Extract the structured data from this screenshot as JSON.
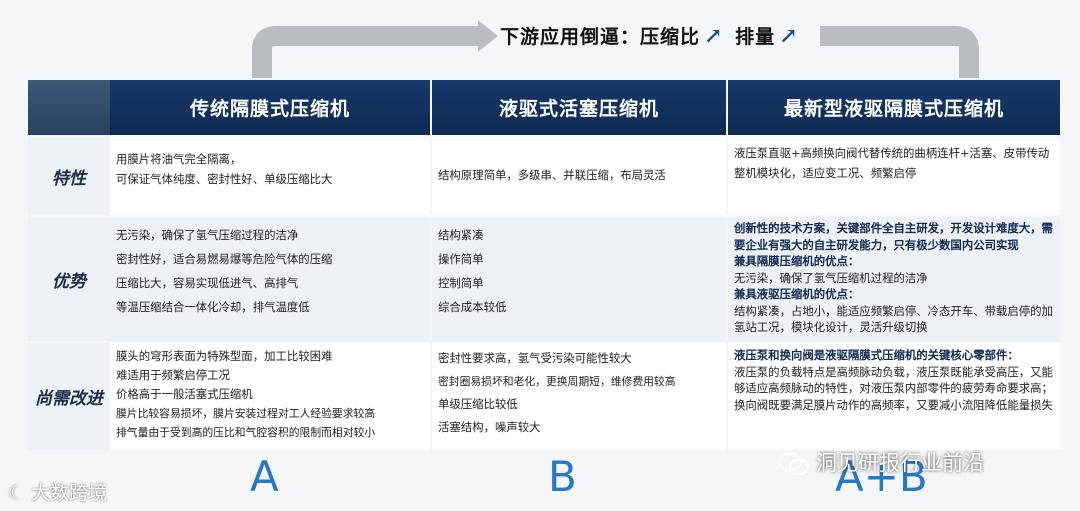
{
  "headline": {
    "text1": "下游应用倒逼：压缩比",
    "text2": "排量",
    "arrow_glyph": "↗"
  },
  "columns": [
    "传统隔膜式压缩机",
    "液驱式活塞压缩机",
    "最新型液驱隔膜式压缩机"
  ],
  "rows": [
    {
      "label": "特性",
      "col1": [
        "用膜片将油气完全隔离，",
        "可保证气体纯度、密封性好、单级压缩比大"
      ],
      "col2": [
        "结构原理简单，多级串、并联压缩，布局灵活"
      ],
      "col3": [
        "液压泵直驱+高频换向阀代替传统的曲柄连杆+活塞、皮带传动",
        "整机模块化，适应变工况、频繁启停"
      ]
    },
    {
      "label": "优势",
      "col1": [
        "无污染，确保了氢气压缩过程的洁净",
        "密封性好，适合易燃易爆等危险气体的压缩",
        "压缩比大，容易实现低进气、高排气",
        "等温压缩结合一体化冷却，排气温度低"
      ],
      "col2": [
        "结构紧凑",
        "操作简单",
        "控制简单",
        "综合成本较低"
      ],
      "col3_bold1": "创新性的技术方案，关键部件全自主研发，开发设计难度大，需要企业有强大的自主研发能力，只有极少数国内公司实现",
      "col3_bold2": "兼具隔膜压缩机的优点：",
      "col3_text2": "无污染，确保了氢气压缩机过程的洁净",
      "col3_bold3": "兼具液驱压缩机的优点：",
      "col3_text3": "结构紧凑，占地小，能适应频繁启停、冷态开车、带载启停的加氢站工况，模块化设计，灵活升级切换"
    },
    {
      "label": "尚需改进",
      "col1": [
        "膜头的穹形表面为特殊型面，加工比较困难",
        "难适用于频繁启停工况",
        "价格高于一般活塞式压缩机",
        "膜片比较容易损坏，膜片安装过程对工人经验要求较高",
        "排气量由于受到高的压比和气腔容积的限制而相对较小"
      ],
      "col2": [
        "密封性要求高，氢气受污染可能性较大",
        "密封圈易损坏和老化，更换周期短，维修费用较高",
        "单级压缩比较低",
        "活塞结构，噪声较大"
      ],
      "col3_bold": "液压泵和换向阀是液驱隔膜式压缩机的关键核心零部件：",
      "col3_text": "液压泵的负载特点是高频脉动负载，液压泵既能承受高压，又能够适应高频脉动的特性，对液压泵内部零件的疲劳寿命要求高；换向阀既要满足膜片动作的高频率，又要减小流阻降低能量损失"
    }
  ],
  "bottom_letters": [
    "A",
    "B",
    "A+B"
  ],
  "brand": "大数跨境",
  "wechat": "洞见研报行业前沿",
  "colors": {
    "header": "#0e2a52",
    "accent": "#2878c8"
  }
}
